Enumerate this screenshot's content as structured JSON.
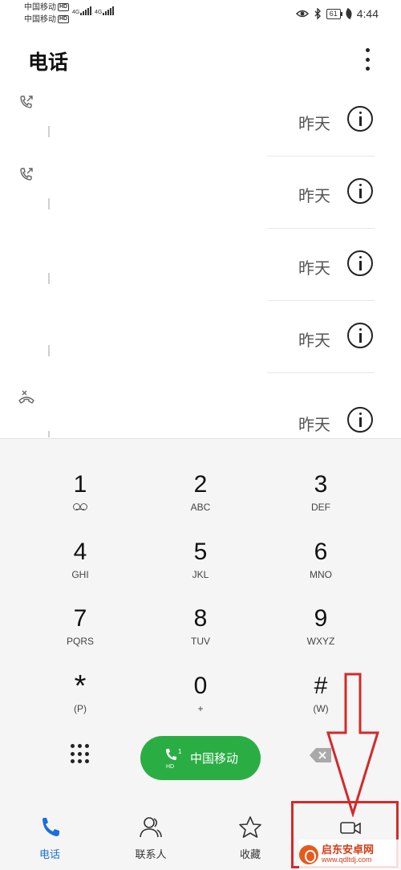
{
  "status_bar": {
    "carrier1": "中国移动",
    "carrier2": "中国移动",
    "hd_badge": "HD",
    "network": "4G",
    "battery": "61",
    "time": "4:44",
    "icons": [
      "eye-icon",
      "bluetooth-icon",
      "battery-icon",
      "leaf-icon"
    ]
  },
  "header": {
    "title": "电话",
    "menu_icon": "more-vertical-icon"
  },
  "call_log": {
    "items": [
      {
        "type_icon": "outgoing-call-icon",
        "time": "昨天"
      },
      {
        "type_icon": "outgoing-call-icon",
        "time": "昨天"
      },
      {
        "type_icon": "none",
        "time": "昨天"
      },
      {
        "type_icon": "none",
        "time": "昨天"
      },
      {
        "type_icon": "missed-call-icon",
        "time": "昨天"
      }
    ]
  },
  "keypad": {
    "keys": [
      {
        "digit": "1",
        "letters": ""
      },
      {
        "digit": "2",
        "letters": "ABC"
      },
      {
        "digit": "3",
        "letters": "DEF"
      },
      {
        "digit": "4",
        "letters": "GHI"
      },
      {
        "digit": "5",
        "letters": "JKL"
      },
      {
        "digit": "6",
        "letters": "MNO"
      },
      {
        "digit": "7",
        "letters": "PQRS"
      },
      {
        "digit": "8",
        "letters": "TUV"
      },
      {
        "digit": "9",
        "letters": "WXYZ"
      },
      {
        "digit": "*",
        "letters": "(P)"
      },
      {
        "digit": "0",
        "letters": "+"
      },
      {
        "digit": "#",
        "letters": "(W)"
      }
    ],
    "call_button": {
      "label": "中国移动",
      "sim": "1",
      "hd": "HD"
    },
    "call_color": "#2aae44"
  },
  "bottom_nav": {
    "tabs": [
      {
        "label": "电话",
        "icon": "phone-icon",
        "active": true
      },
      {
        "label": "联系人",
        "icon": "contacts-icon",
        "active": false
      },
      {
        "label": "收藏",
        "icon": "star-icon",
        "active": false
      },
      {
        "label": "",
        "icon": "video-call-icon",
        "active": false
      }
    ],
    "active_color": "#1c6fd6"
  },
  "annotation": {
    "color": "#d42a2a"
  },
  "watermark": {
    "title": "启东安卓网",
    "url": "www.qdltdj.com"
  }
}
